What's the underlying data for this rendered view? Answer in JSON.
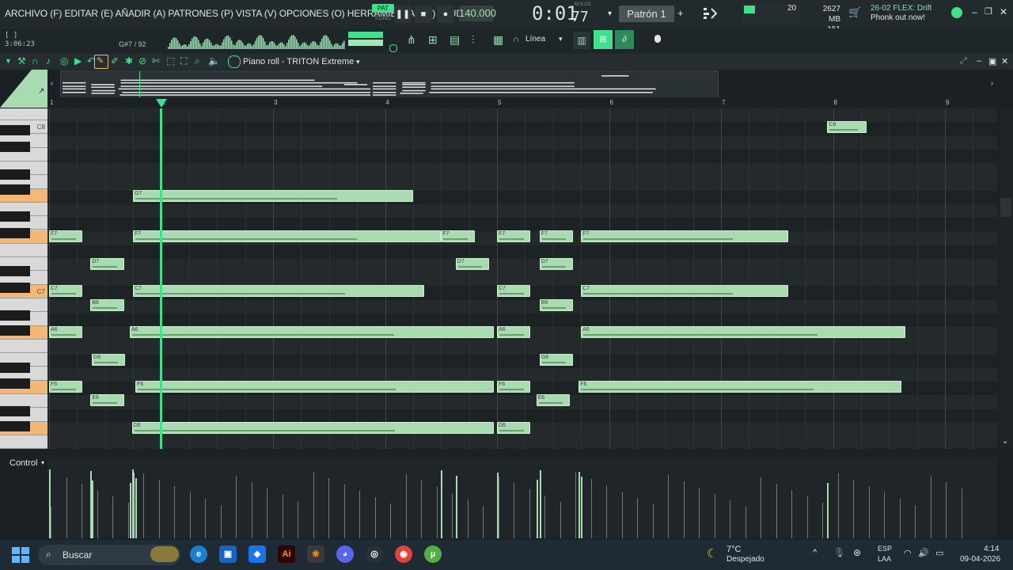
{
  "menu": "ARCHIVO (F) EDITAR (E) AÑADIR (A) PATRONES (P) VISTA (V) OPCIONES (O) HERRAMIENTAS (T) AYUDA",
  "transport": {
    "pat_label": "PAT",
    "song_label": "SONG",
    "tempo": "140.000",
    "time_main": "0:01",
    "time_sub": "77",
    "time_label": "M:S:CS",
    "pattern": "Patrón 1"
  },
  "system": {
    "cpu": "20",
    "memory": "2627 MB",
    "voices": "151",
    "news_title": "26-02  FLEX: Drift",
    "news_sub": "Phonk out now!"
  },
  "hint": {
    "line1": "[ ]",
    "line2": "3:06:23",
    "note": "G#7 / 92"
  },
  "piano_roll": {
    "title": "Piano roll - TRITON Extreme",
    "snap": "Línea",
    "bars": [
      "1",
      "2",
      "3",
      "4",
      "5",
      "6",
      "7",
      "8",
      "9"
    ],
    "control_label": "Control",
    "keys": [
      "C8",
      "C7"
    ],
    "notes": [
      {
        "label": "C8",
        "row": 1,
        "start": 7.95,
        "len": 0.35
      },
      {
        "label": "G7",
        "row": 6,
        "start": 1.75,
        "len": 2.5
      },
      {
        "label": "F7",
        "row": 9,
        "start": 1.0,
        "len": 0.3
      },
      {
        "label": "F7",
        "row": 9,
        "start": 1.75,
        "len": 2.75
      },
      {
        "label": "F7",
        "row": 9,
        "start": 4.5,
        "len": 0.3
      },
      {
        "label": "F7",
        "row": 9,
        "start": 5.0,
        "len": 0.3
      },
      {
        "label": "F7",
        "row": 9,
        "start": 5.38,
        "len": 0.3
      },
      {
        "label": "F7",
        "row": 9,
        "start": 5.75,
        "len": 1.85
      },
      {
        "label": "D7",
        "row": 11,
        "start": 1.37,
        "len": 0.3
      },
      {
        "label": "D7",
        "row": 11,
        "start": 4.63,
        "len": 0.3
      },
      {
        "label": "D7",
        "row": 11,
        "start": 5.38,
        "len": 0.3
      },
      {
        "label": "C7",
        "row": 13,
        "start": 1.0,
        "len": 0.3
      },
      {
        "label": "C7",
        "row": 13,
        "start": 1.75,
        "len": 2.6
      },
      {
        "label": "C7",
        "row": 13,
        "start": 5.0,
        "len": 0.3
      },
      {
        "label": "C7",
        "row": 13,
        "start": 5.75,
        "len": 1.85
      },
      {
        "label": "B6",
        "row": 14,
        "start": 1.37,
        "len": 0.3
      },
      {
        "label": "B6",
        "row": 14,
        "start": 5.38,
        "len": 0.3
      },
      {
        "label": "A6",
        "row": 16,
        "start": 1.0,
        "len": 0.3
      },
      {
        "label": "A6",
        "row": 16,
        "start": 1.72,
        "len": 3.25
      },
      {
        "label": "A6",
        "row": 16,
        "start": 5.0,
        "len": 0.3
      },
      {
        "label": "A6",
        "row": 16,
        "start": 5.75,
        "len": 2.9
      },
      {
        "label": "G6",
        "row": 18,
        "start": 1.38,
        "len": 0.3
      },
      {
        "label": "G6",
        "row": 18,
        "start": 5.38,
        "len": 0.3
      },
      {
        "label": "F6",
        "row": 20,
        "start": 1.0,
        "len": 0.3
      },
      {
        "label": "F6",
        "row": 20,
        "start": 1.77,
        "len": 3.2
      },
      {
        "label": "F6",
        "row": 20,
        "start": 5.0,
        "len": 0.3
      },
      {
        "label": "F6",
        "row": 20,
        "start": 5.73,
        "len": 2.88
      },
      {
        "label": "E6",
        "row": 21,
        "start": 1.37,
        "len": 0.3
      },
      {
        "label": "E6",
        "row": 21,
        "start": 5.35,
        "len": 0.3
      },
      {
        "label": "D6",
        "row": 23,
        "start": 1.74,
        "len": 3.23
      },
      {
        "label": "D6",
        "row": 23,
        "start": 5.0,
        "len": 0.3
      }
    ]
  },
  "taskbar": {
    "search": "Buscar",
    "temp": "7°C",
    "weather": "Despejado",
    "lang1": "ESP",
    "lang2": "LAA",
    "time": "4:14",
    "date": "09-04-2026"
  }
}
